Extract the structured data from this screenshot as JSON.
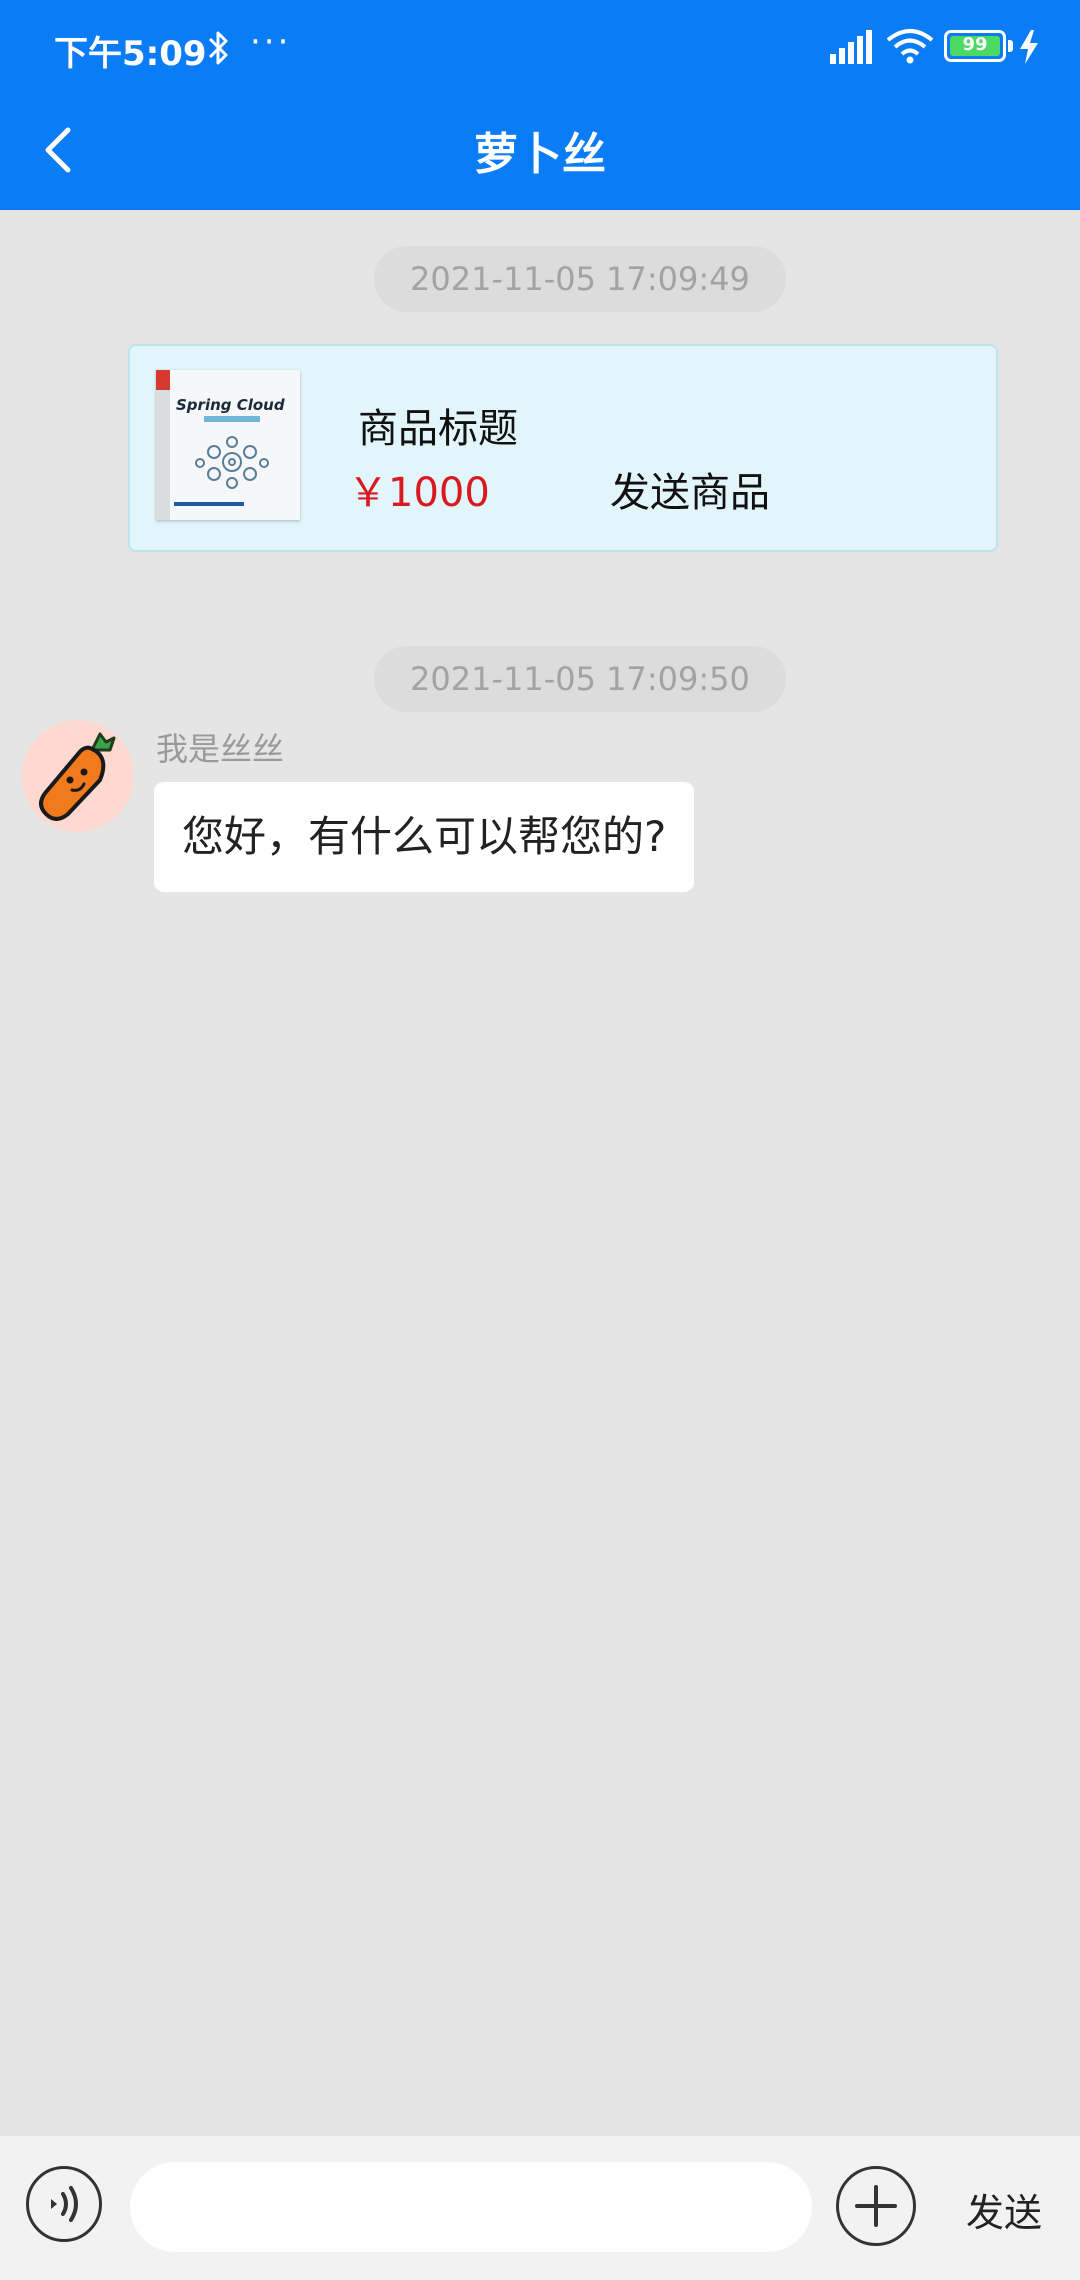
{
  "status_bar": {
    "time": "下午5:09",
    "more": "···",
    "battery": "99",
    "icons": [
      "bluetooth-icon",
      "signal-icon",
      "wifi-icon",
      "battery-icon",
      "charging-icon"
    ]
  },
  "header": {
    "title": "萝卜丝",
    "back_icon": "chevron-left-icon",
    "background": "#0a7cf5"
  },
  "messages": {
    "timestamp_1": "2021-11-05 17:09:49",
    "product": {
      "image_title": "Spring Cloud",
      "title": "商品标题",
      "price": "￥1000",
      "send_label": "发送商品"
    },
    "timestamp_2": "2021-11-05 17:09:50",
    "sender_name": "我是丝丝",
    "text": "您好，有什么可以帮您的?"
  },
  "input_bar": {
    "placeholder": "",
    "send_label": "发送",
    "icons": [
      "voice-icon",
      "plus-icon"
    ]
  },
  "colors": {
    "primary": "#0a7cf5",
    "price": "#d8191f",
    "chat_bg": "#e5e5e5",
    "card_bg": "#e2f5fa"
  }
}
